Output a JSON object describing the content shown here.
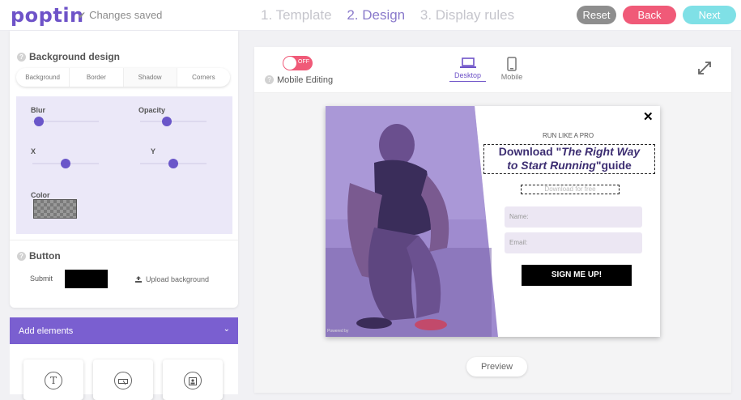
{
  "app": {
    "logo": "poptin",
    "save_status": "Changes saved",
    "steps": [
      "1. Template",
      "2. Design",
      "3. Display rules"
    ],
    "active_step": "2. Design",
    "buttons": {
      "reset": "Reset",
      "back": "Back",
      "next": "Next"
    },
    "colors": {
      "brand": "#6e53c8",
      "back": "#f05a78",
      "next": "#7fe0e6",
      "reset": "#8e8e8e"
    }
  },
  "left": {
    "background_design": {
      "title": "Background design",
      "tabs": [
        "Background",
        "Border",
        "Shadow",
        "Corners"
      ],
      "active_tab": "Shadow",
      "shadow": {
        "blur_label": "Blur",
        "opacity_label": "Opacity",
        "x_label": "X",
        "y_label": "Y",
        "color_label": "Color",
        "blur_value": 0.1,
        "opacity_value": 0.4,
        "x_value": 0.5,
        "y_value": 0.5
      }
    },
    "button_section": {
      "title": "Button",
      "submit_label": "Submit",
      "upload_label": "Upload background"
    },
    "add_elements": {
      "title": "Add elements",
      "items": [
        "text-icon",
        "button-icon",
        "image-icon"
      ]
    }
  },
  "editor": {
    "toggle_text": "OFF",
    "mobile_editing": "Mobile Editing",
    "devices": {
      "desktop": "Desktop",
      "mobile": "Mobile"
    },
    "active_device": "Desktop",
    "preview": "Preview"
  },
  "popup": {
    "eyebrow": "RUN LIKE A PRO",
    "headline_pre": "Download \"",
    "headline_em1": "The Right Way",
    "headline_em2": "to Start Running",
    "headline_post": "\"guide",
    "subtext": "Download for free",
    "name_placeholder": "Name:",
    "email_placeholder": "Email:",
    "cta": "SIGN ME UP!",
    "powered": "Powered by"
  }
}
